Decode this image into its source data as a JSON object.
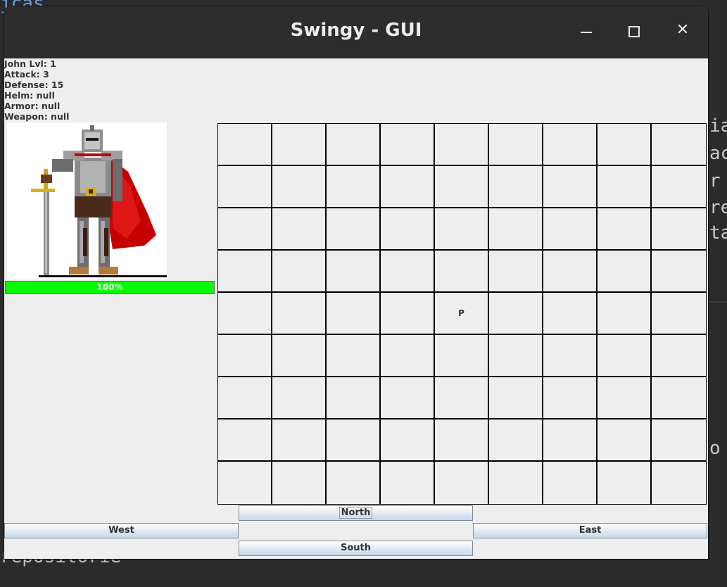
{
  "window": {
    "title": "Swingy - GUI"
  },
  "hero": {
    "stats": [
      "John Lvl: 1",
      "Attack: 3",
      "Defense: 15",
      "Helm: null",
      "Armor: null",
      "Weapon: null"
    ],
    "health_label": "100%",
    "health_percent": 100
  },
  "map": {
    "rows": 9,
    "cols": 9,
    "player_marker": "P",
    "player_row": 4,
    "player_col": 4
  },
  "controls": {
    "north": "North",
    "west": "West",
    "east": "East",
    "south": "South"
  },
  "background": {
    "top": "jcas",
    "right_lines": [
      "ia",
      "ac",
      "r",
      "re",
      "ta"
    ],
    "right_lower": "o",
    "bottom": "repositorie"
  },
  "colors": {
    "health": "#00ff00",
    "titlebar": "#2d2d2d",
    "window_bg": "#eeeeee"
  }
}
